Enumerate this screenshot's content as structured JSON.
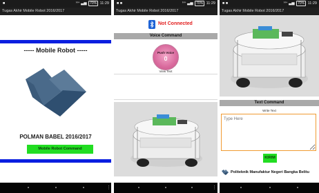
{
  "colors": {
    "accent_blue": "#0a1ee0",
    "button_green": "#22dd22",
    "status_red": "#e21c1c",
    "section_gray": "#a9a9a9",
    "input_border_orange": "#f09a30"
  },
  "status_bar": {
    "signal": "ᴴ⁺",
    "battery": "70%",
    "time": "11:29"
  },
  "app_title": "Tugas Akhir Mobile Robot 2016/2017",
  "screen_home": {
    "heading": "----- Mobile Robot -----",
    "institution": "POLMAN BABEL 2016/2017",
    "command_button": "Mobile Robot Command",
    "logo_icon": "polman-logo"
  },
  "screen_voice": {
    "bluetooth_icon": "bluetooth-icon",
    "connection_status": "Not Connected",
    "section_title": "Voice Command",
    "push_voice_label": "Push Voice",
    "view_text_label": "View Text",
    "view_text_value": ""
  },
  "screen_text": {
    "section_title": "Text Command",
    "write_text_label": "Write Text",
    "input_placeholder": "Type Here",
    "send_button": "KIRIM",
    "footer_brand": "Politeknik Manufaktur Negeri Bangka Belitu"
  }
}
